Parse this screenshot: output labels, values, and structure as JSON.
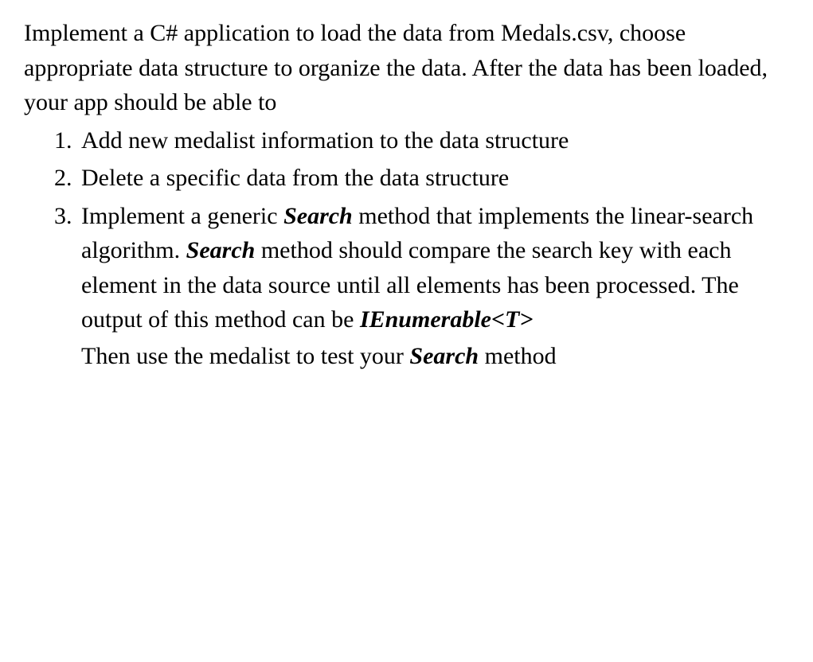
{
  "intro": "Implement a C# application to load the data from Medals.csv, choose appropriate data structure to organize the data. After the data has been loaded, your app should be able to",
  "items": [
    {
      "text": "Add new medalist information to the data structure"
    },
    {
      "text": "Delete a specific data from the data structure"
    },
    {
      "part1": "Implement a generic ",
      "bi1": "Search",
      "part2": " method that implements the linear-search algorithm. ",
      "bi2": "Search",
      "part3": " method should compare the search key with each element in the data source until all elements has been processed. The output of this method can be ",
      "bi3": "IEnumerable<T>",
      "follow_part1": "Then use the medalist to test your ",
      "follow_bi": "Search",
      "follow_part2": " method"
    }
  ]
}
